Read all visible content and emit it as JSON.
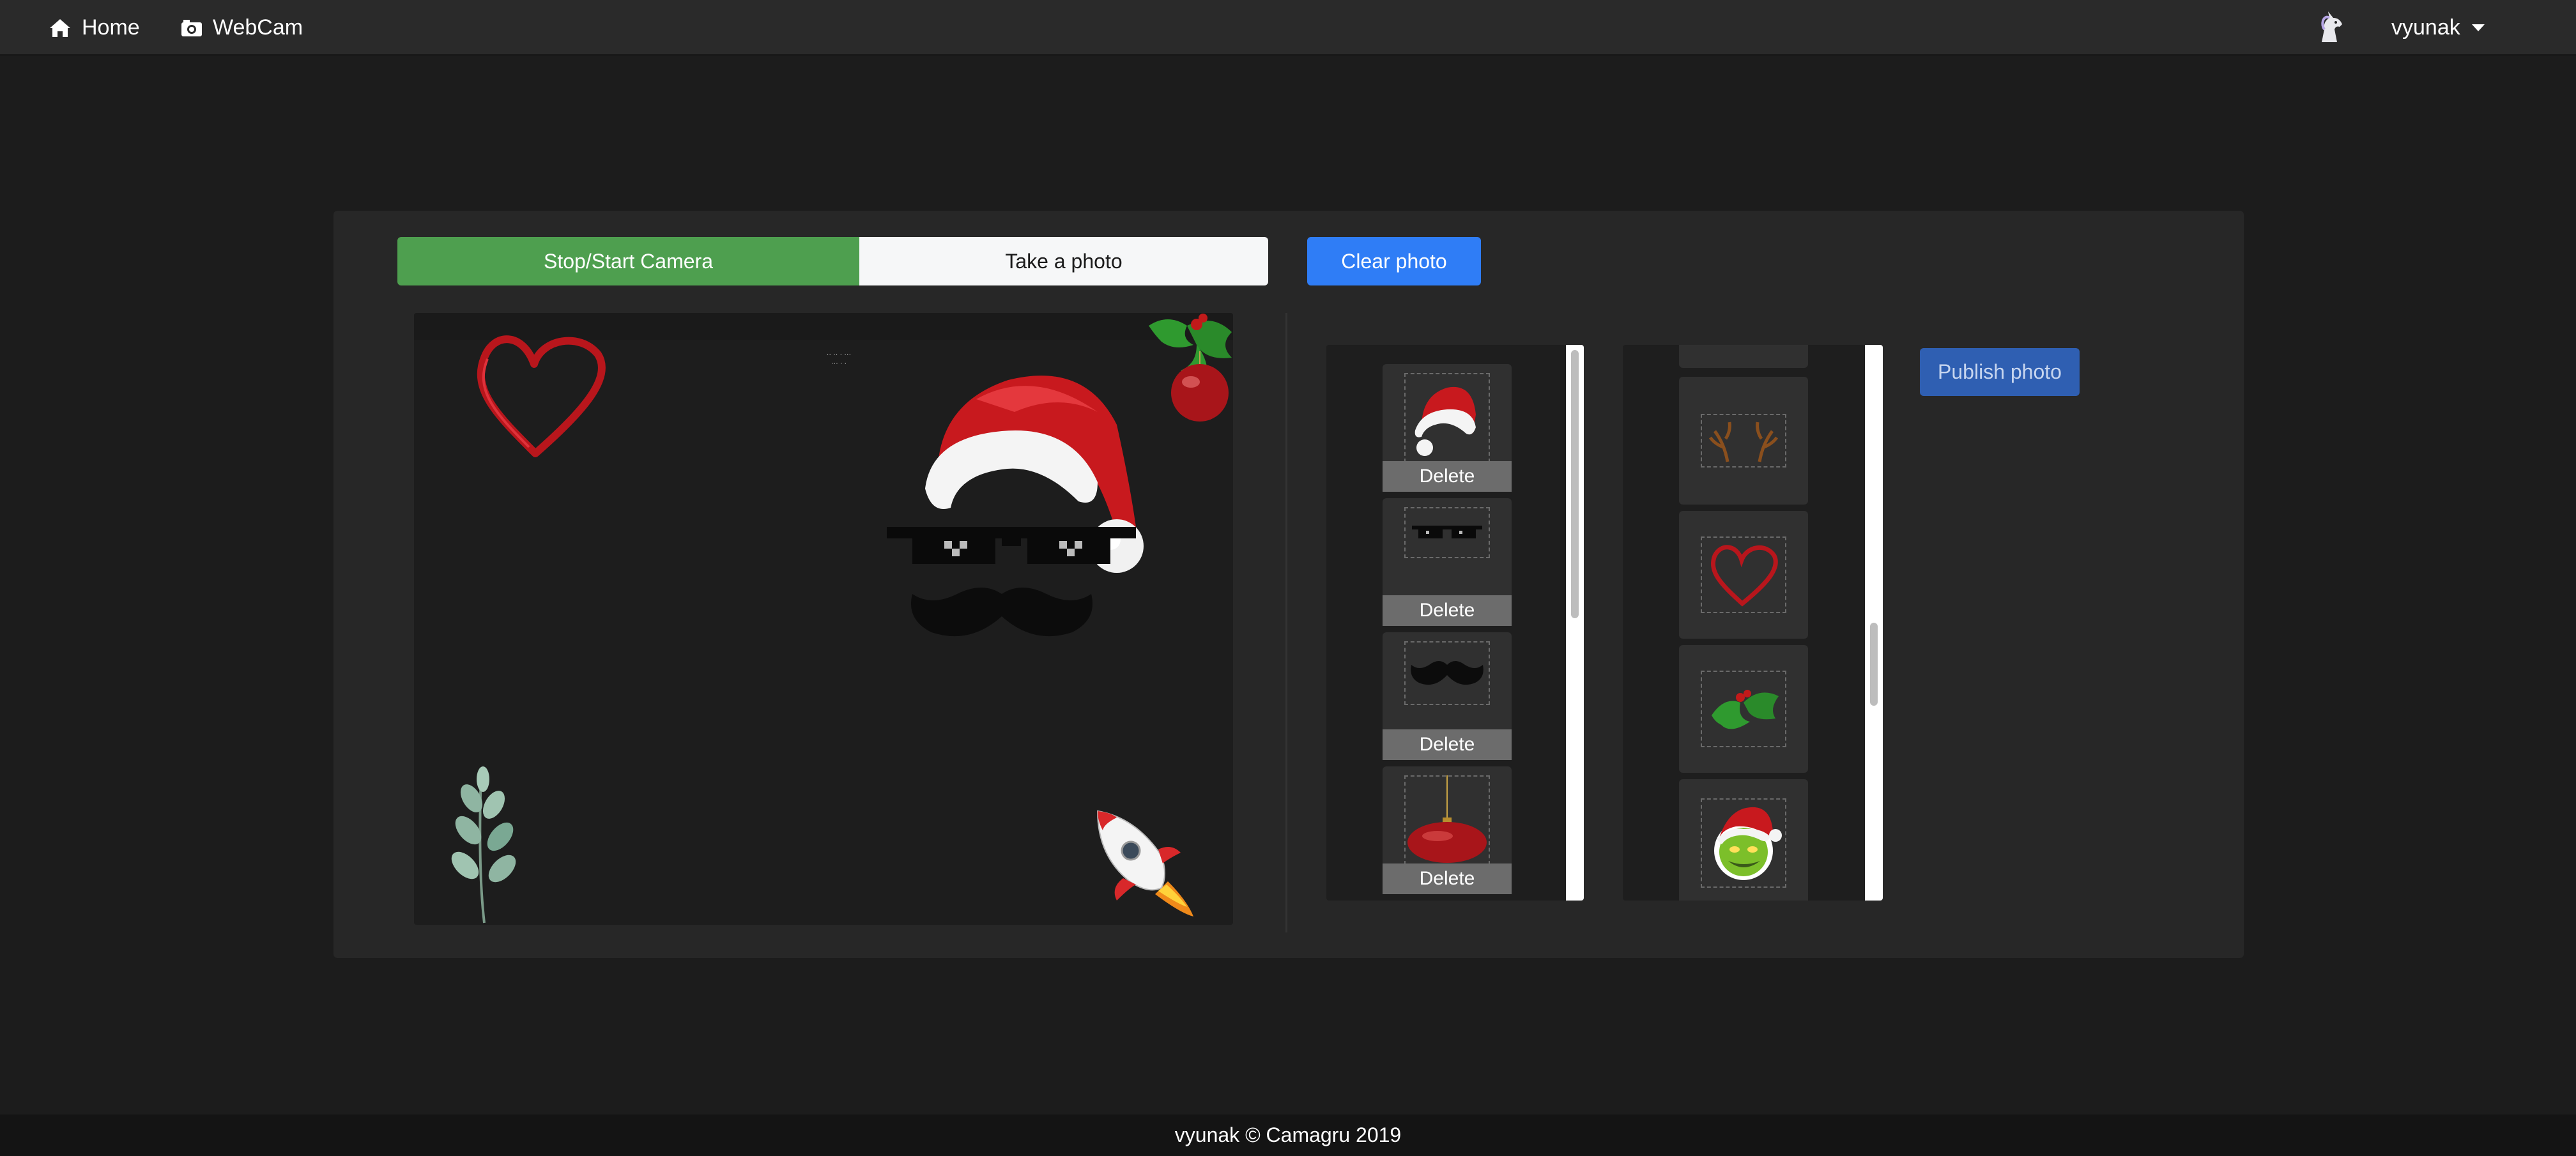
{
  "navbar": {
    "home_label": "Home",
    "webcam_label": "WebCam",
    "user_label": "vyunak"
  },
  "controls": {
    "camera_label": "Stop/Start Camera",
    "take_photo_label": "Take a photo",
    "clear_label": "Clear photo",
    "publish_label": "Publish photo"
  },
  "used_stickers": {
    "items": [
      {
        "icon": "santa-hat-icon",
        "delete_label": "Delete"
      },
      {
        "icon": "pixel-sunglasses-icon",
        "delete_label": "Delete"
      },
      {
        "icon": "mustache-icon",
        "delete_label": "Delete"
      },
      {
        "icon": "christmas-ornament-icon",
        "delete_label": "Delete"
      }
    ]
  },
  "sticker_library": {
    "items": [
      {
        "icon": "antlers-icon"
      },
      {
        "icon": "heart-icon"
      },
      {
        "icon": "holly-icon"
      },
      {
        "icon": "grinch-icon"
      }
    ]
  },
  "footer": {
    "text": "vyunak © Camagru 2019"
  },
  "colors": {
    "camera_button": "#4e9f4f",
    "clear_button": "#2f7df6",
    "publish_button": "#2f5fb2",
    "background": "#1c1c1c",
    "panel": "#272727"
  }
}
